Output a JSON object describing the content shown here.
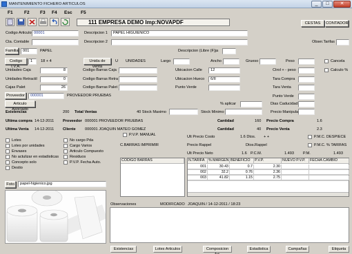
{
  "window": {
    "title": "MANTENIMIENTO FICHERO ARTICULOS",
    "minimize": "_",
    "maximize": "□",
    "close": "✕"
  },
  "fkeys": [
    "F1",
    "F2",
    "F3",
    "F4",
    "Esc",
    "F5"
  ],
  "toolbar": {
    "icons": [
      "new-icon",
      "save-icon",
      "delete-icon",
      "print-icon",
      "undo-icon"
    ]
  },
  "company": "111 EMPRESA DEMO Imp:NOVAPDF",
  "top_buttons": {
    "cestas": "CESTAS",
    "contador": "CONTADOR"
  },
  "form": {
    "codigo_articulo_label": "Codigo Articulo",
    "codigo_articulo": "00001",
    "descripcion1_label": "Descripcion 1",
    "descripcion1": "PAPEL HIGUIENICO",
    "cta_contable_label": "Cta. Contable",
    "descripcion2_label": "Descripcion 2",
    "obser_tarifas_label": "Obser.Tarifas",
    "familia_button": "Familia",
    "familia_code": "001",
    "familia_name": "PAPEL",
    "descripcion_libre_label": "Descripcion (Libre (F)ja",
    "codigo_iva_button": "Codigo I.V.A.",
    "iva_code": "1",
    "iva_rate": "18 + 4",
    "unidad_venta_button": "Unida de venta",
    "unidad_code": "U",
    "unidad_name": "UNIDADES",
    "largo_label": "Largo",
    "ancho_label": "Ancho",
    "grueso_label": "Grueso",
    "peso_label": "Peso",
    "cancela_label": "Cancela",
    "unidades_caja_label": "Unidades Caja",
    "unidades_caja": "8",
    "codigo_barras_caja_label": "Codigo Barras Caja",
    "ubicacion_calle_label": "Ubicacion Calle",
    "ubicacion_calle": "12",
    "ctrol_peso_label": "Ctrol + - peso",
    "calculo_label": "Calculo %",
    "unidades_retractil_label": "Unidades Retractil",
    "unidades_retractil": "0",
    "codigo_barras_retra_label": "Codigo Barras Retra",
    "ubicacion_hueco_label": "Ubicacion Hueco",
    "ubicacion_hueco": "6/II",
    "tara_compra_label": "Tara Compra",
    "cajas_palet_label": "Cajas Palet",
    "cajas_palet": "26",
    "codigo_barras_palet_label": "Codigo Barras Palet",
    "punto_verde_label": "Punto Verde",
    "tara_venta_label": "Tara Venta",
    "proveedor_button": "Proveedor",
    "proveedor_code": "000001",
    "proveedor_name": "PROVEEDOR PRUEBAS",
    "punto_verde2_label": "Punto Verde",
    "articulo_asociado_button": "Articulo Asociado",
    "aplicar_label": "% aplicar",
    "dias_caducidad_label": "Dias Caducidad",
    "existencias_label": "Existencias",
    "existencias": "200",
    "total_ventas_label": "Total Ventas",
    "stock_maximo_label": "40 Stock Maximo",
    "stock_minimo_label": "Stock Minimo",
    "precio_manipula_label": "Precio Manipula",
    "ultima_compra_label": "Ultima compra",
    "ultima_compra": "14-12-2011",
    "proveedor2_label": "Proveedor",
    "proveedor2": "000001 PROVEEDOR PRUEBAS",
    "cantidad1_label": "Cantidad",
    "cantidad1": "160",
    "precio_compra_label": "Precio Compra",
    "precio_compra": "1.6",
    "ultima_venta_label": "Ultima Venta",
    "ultima_venta": "14-12-2011",
    "cliente_label": "Cliente",
    "cliente": "000001 JOAQUIN MATEO GOMEZ",
    "cantidad2_label": "Cantidad",
    "cantidad2": "40",
    "precio_venta_label": "Precio Venta",
    "precio_venta": "2.3"
  },
  "checks": {
    "pvp_manual": "P.V.P. MANUAL",
    "left": [
      "Lotes",
      "Lotes por unidades",
      "Envases",
      "No actulizar en estadisticas",
      "Concepto solo",
      "Destio"
    ],
    "mid": [
      "No cargo Pda",
      "Cargo Varios",
      "Articulo Compuesto",
      "Residuos",
      "P.V.P. Fecha Auto."
    ],
    "right": [
      "P.M.C. DESPIECE",
      "P.M.C. % TARIFAS"
    ]
  },
  "costs": {
    "ult_precio_costo_label": "Ult Precio Costo",
    "ult_precio_costo": "1.6 Dtos.",
    "dtos_plus": "+ +",
    "ult_precio_neto_label": "Ult Precio Neto",
    "ult_precio_neto": "1.6",
    "pcm_label": "P.C.M.",
    "pcm": "1.493",
    "pm_label": "P.M.",
    "pm": "1.493",
    "precio_rappel_label": "Precio Rappel",
    "dtos_rappel_label": "Dtos.Rappel",
    "barras_imprimir_label": "C.BARRAS IMPRIMIR"
  },
  "barcodes": {
    "header": "CODIGO BARRAS"
  },
  "tarifas": {
    "headers": [
      "N.TARIFA",
      "% MARGEN",
      "BENEFICIO",
      "P.V.P.",
      "NUEVO P.V.P.",
      "FECHA CAMBIO"
    ],
    "rows": [
      [
        "001",
        "30.43",
        "0.7",
        "2.30",
        "",
        ""
      ],
      [
        "002",
        "32.2",
        "0.76",
        "2.36",
        "",
        ""
      ],
      [
        "003",
        "41.82",
        "1.15",
        "2.75",
        "",
        ""
      ]
    ]
  },
  "photo": {
    "button": "Foto",
    "filename": "papel-higienico.jpg"
  },
  "observaciones": {
    "label": "Observaciones",
    "modified": "MODIFICADO",
    "user": "JOAQUIN / 14-12-2011 / 18:23"
  },
  "bottom_buttons": [
    "Existencias",
    "Lotes Articulos",
    "Composicion Art.",
    "Estadistica",
    "Campañas",
    "Etiqueta"
  ]
}
